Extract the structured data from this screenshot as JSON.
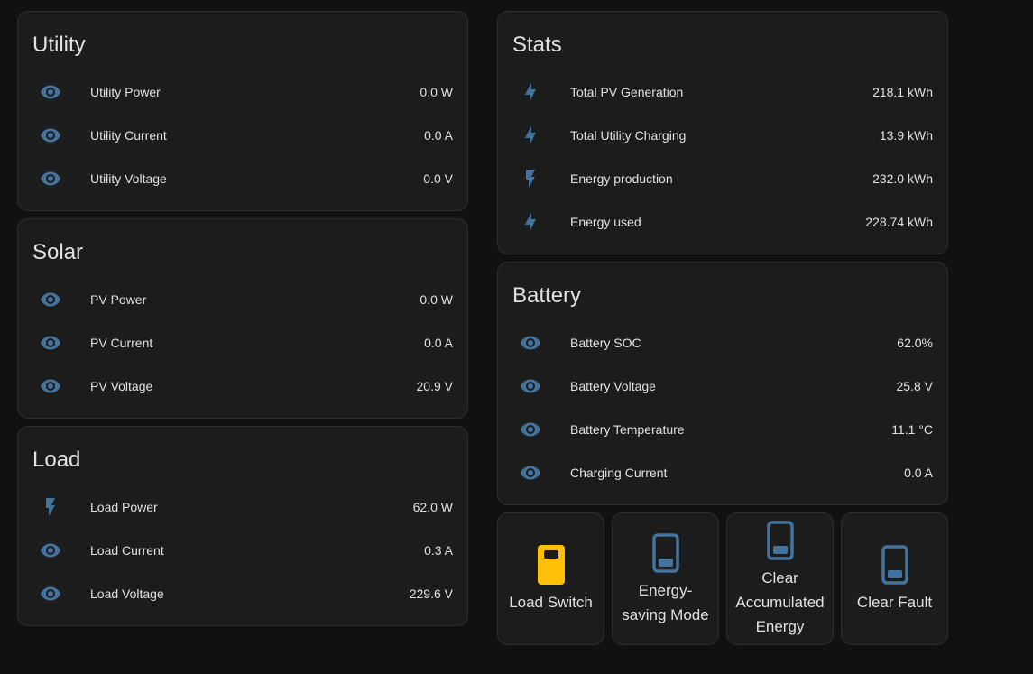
{
  "colors": {
    "background": "#111111",
    "card": "#1c1c1c",
    "icon_blue": "#44739e",
    "switch_on": "#ffc107"
  },
  "utility": {
    "title": "Utility",
    "rows": [
      {
        "icon": "eye-icon",
        "label": "Utility Power",
        "value": "0.0 W"
      },
      {
        "icon": "eye-icon",
        "label": "Utility Current",
        "value": "0.0 A"
      },
      {
        "icon": "eye-icon",
        "label": "Utility Voltage",
        "value": "0.0 V"
      }
    ]
  },
  "solar": {
    "title": "Solar",
    "rows": [
      {
        "icon": "eye-icon",
        "label": "PV Power",
        "value": "0.0 W"
      },
      {
        "icon": "eye-icon",
        "label": "PV Current",
        "value": "0.0 A"
      },
      {
        "icon": "eye-icon",
        "label": "PV Voltage",
        "value": "20.9 V"
      }
    ]
  },
  "load": {
    "title": "Load",
    "rows": [
      {
        "icon": "flash-icon",
        "label": "Load Power",
        "value": "62.0 W"
      },
      {
        "icon": "eye-icon",
        "label": "Load Current",
        "value": "0.3 A"
      },
      {
        "icon": "eye-icon",
        "label": "Load Voltage",
        "value": "229.6 V"
      }
    ]
  },
  "stats": {
    "title": "Stats",
    "rows": [
      {
        "icon": "lightning-bolt-icon",
        "label": "Total PV Generation",
        "value": "218.1 kWh"
      },
      {
        "icon": "lightning-bolt-icon",
        "label": "Total Utility Charging",
        "value": "13.9 kWh"
      },
      {
        "icon": "flash-icon",
        "label": "Energy production",
        "value": "232.0 kWh"
      },
      {
        "icon": "lightning-bolt-icon",
        "label": "Energy used",
        "value": "228.74 kWh"
      }
    ]
  },
  "battery": {
    "title": "Battery",
    "rows": [
      {
        "icon": "eye-icon",
        "label": "Battery SOC",
        "value": "62.0%"
      },
      {
        "icon": "eye-icon",
        "label": "Battery Voltage",
        "value": "25.8 V"
      },
      {
        "icon": "eye-icon",
        "label": "Battery Temperature",
        "value": "11.1 °C"
      },
      {
        "icon": "eye-icon",
        "label": "Charging Current",
        "value": "0.0 A"
      }
    ]
  },
  "buttons": [
    {
      "label": "Load Switch",
      "icon": "switch-on-icon",
      "state": "on"
    },
    {
      "label": "Energy-saving Mode",
      "icon": "switch-off-icon",
      "state": "off"
    },
    {
      "label": "Clear Accumulated Energy",
      "icon": "switch-off-icon",
      "state": "off"
    },
    {
      "label": "Clear Fault",
      "icon": "switch-off-icon",
      "state": "off"
    }
  ]
}
